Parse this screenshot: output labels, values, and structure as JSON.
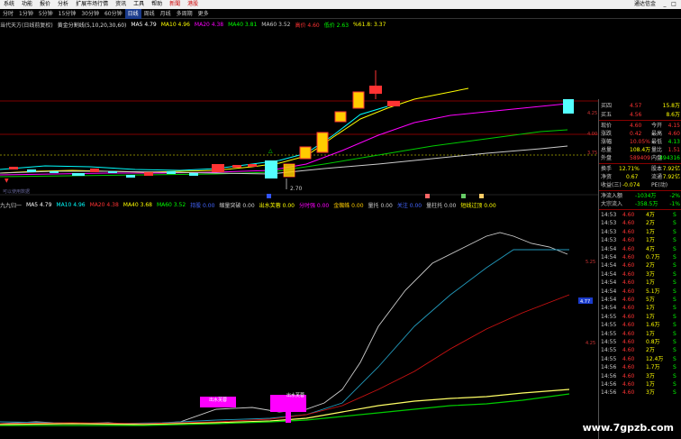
{
  "menubar": {
    "items": [
      "系统",
      "功能",
      "报价",
      "分析",
      "扩展市场行情",
      "资讯",
      "工具",
      "帮助",
      "新聞",
      "港股"
    ],
    "window_title": "通达信金",
    "win_buttons": [
      "_",
      "□"
    ]
  },
  "periodbar": {
    "tabs": [
      "分时",
      "1分钟",
      "5分钟",
      "15分钟",
      "30分钟",
      "60分钟",
      "日线",
      "周线",
      "月线",
      "多周期",
      "更多"
    ],
    "active_tab": "日线"
  },
  "info_main": {
    "title": "当代天方(日线前复权)",
    "indicator": "黄金分割线(5,10,20,30,60)",
    "ma5": "MA5 4.79",
    "ma10": "MA10 4.96",
    "ma20": "MA20 4.38",
    "ma40": "MA40 3.81",
    "ma60": "MA60 3.52",
    "v1": "高价 4.60",
    "v2": "低价 2.63",
    "v3": "%61.8: 3.37"
  },
  "info_sub": {
    "name": "九九归一",
    "ma5": "MA5 4.79",
    "ma10": "MA10 4.96",
    "ma20": "MA20 4.38",
    "ma40": "MA40 3.68",
    "ma60": "MA60 3.52",
    "blue": "持股 0.00",
    "s1": "缩量突破 0.00",
    "s2": "出水芙蓉 0.00",
    "s3": "分时强 0.00",
    "s4": "金蜘蛛 0.00",
    "s5": "量托 0.00",
    "s6": "关注 0.00",
    "s7": "量柱托 0.00",
    "s8": "短线过顶 0.00"
  },
  "chart_labels": {
    "low_price": "2.70",
    "annot1": "出水芙蓉",
    "annot2": "出水芙蓉",
    "badge_sub": "4.77",
    "left_note": "可以使用数据"
  },
  "quote_table": [
    {
      "label": "买四",
      "value": "4.57",
      "extra": "15.8万"
    },
    {
      "label": "买五",
      "value": "4.56",
      "extra": "8.6万"
    },
    {
      "label": "现价",
      "value": "4.60",
      "label2": "今开",
      "value2": "4.15"
    },
    {
      "label": "涨跌",
      "value": "0.42",
      "label2": "最高",
      "value2": "4.60"
    },
    {
      "label": "涨幅",
      "value": "10.05%",
      "label2": "最低",
      "value2": "4.13"
    },
    {
      "label": "总量",
      "value": "108.4万",
      "label2": "量比",
      "value2": "1.51"
    },
    {
      "label": "外盘",
      "value": "589409",
      "label2": "内盘",
      "value2": "494316"
    },
    {
      "label": "换手",
      "value": "12.71%",
      "label2": "股本",
      "value2": "7.92亿"
    },
    {
      "label": "净资",
      "value": "0.67",
      "label2": "流通",
      "value2": "7.92亿"
    },
    {
      "label": "收益(三)",
      "value": "-0.074",
      "label2": "PE(动)",
      "value2": ""
    }
  ],
  "flow": [
    {
      "label": "净流入额",
      "value": "-1034万",
      "pct": "-2%"
    },
    {
      "label": "大宗流入",
      "value": "-358.5万",
      "pct": "-1%"
    }
  ],
  "ticks": [
    {
      "time": "14:53",
      "price": "4.60",
      "vol": "4万",
      "dir": "S"
    },
    {
      "time": "14:53",
      "price": "4.60",
      "vol": "2万",
      "dir": "S"
    },
    {
      "time": "14:53",
      "price": "4.60",
      "vol": "1万",
      "dir": "S"
    },
    {
      "time": "14:53",
      "price": "4.60",
      "vol": "1万",
      "dir": "S"
    },
    {
      "time": "14:54",
      "price": "4.60",
      "vol": "4万",
      "dir": "S"
    },
    {
      "time": "14:54",
      "price": "4.60",
      "vol": "0.7万",
      "dir": "S"
    },
    {
      "time": "14:54",
      "price": "4.60",
      "vol": "2万",
      "dir": "S"
    },
    {
      "time": "14:54",
      "price": "4.60",
      "vol": "3万",
      "dir": "S"
    },
    {
      "time": "14:54",
      "price": "4.60",
      "vol": "1万",
      "dir": "S"
    },
    {
      "time": "14:54",
      "price": "4.60",
      "vol": "5.1万",
      "dir": "S"
    },
    {
      "time": "14:54",
      "price": "4.60",
      "vol": "5万",
      "dir": "S"
    },
    {
      "time": "14:54",
      "price": "4.60",
      "vol": "1万",
      "dir": "S"
    },
    {
      "time": "14:55",
      "price": "4.60",
      "vol": "1万",
      "dir": "S"
    },
    {
      "time": "14:55",
      "price": "4.60",
      "vol": "1.6万",
      "dir": "S"
    },
    {
      "time": "14:55",
      "price": "4.60",
      "vol": "1万",
      "dir": "S"
    },
    {
      "time": "14:55",
      "price": "4.60",
      "vol": "0.8万",
      "dir": "S"
    },
    {
      "time": "14:55",
      "price": "4.60",
      "vol": "2万",
      "dir": "S"
    },
    {
      "time": "14:55",
      "price": "4.60",
      "vol": "12.4万",
      "dir": "S"
    },
    {
      "time": "14:56",
      "price": "4.60",
      "vol": "1.7万",
      "dir": "S"
    },
    {
      "time": "14:56",
      "price": "4.60",
      "vol": "3万",
      "dir": "S"
    },
    {
      "time": "14:56",
      "price": "4.60",
      "vol": "1万",
      "dir": "S"
    },
    {
      "time": "14:56",
      "price": "4.60",
      "vol": "3万",
      "dir": "S"
    }
  ],
  "watermark": "www.7gpzb.com",
  "colors": {
    "up": "#ff3333",
    "down": "#54ffff",
    "ma5": "#ffffff",
    "ma10": "#ffff00",
    "ma20": "#ff00ff",
    "ma40": "#00ff00"
  }
}
